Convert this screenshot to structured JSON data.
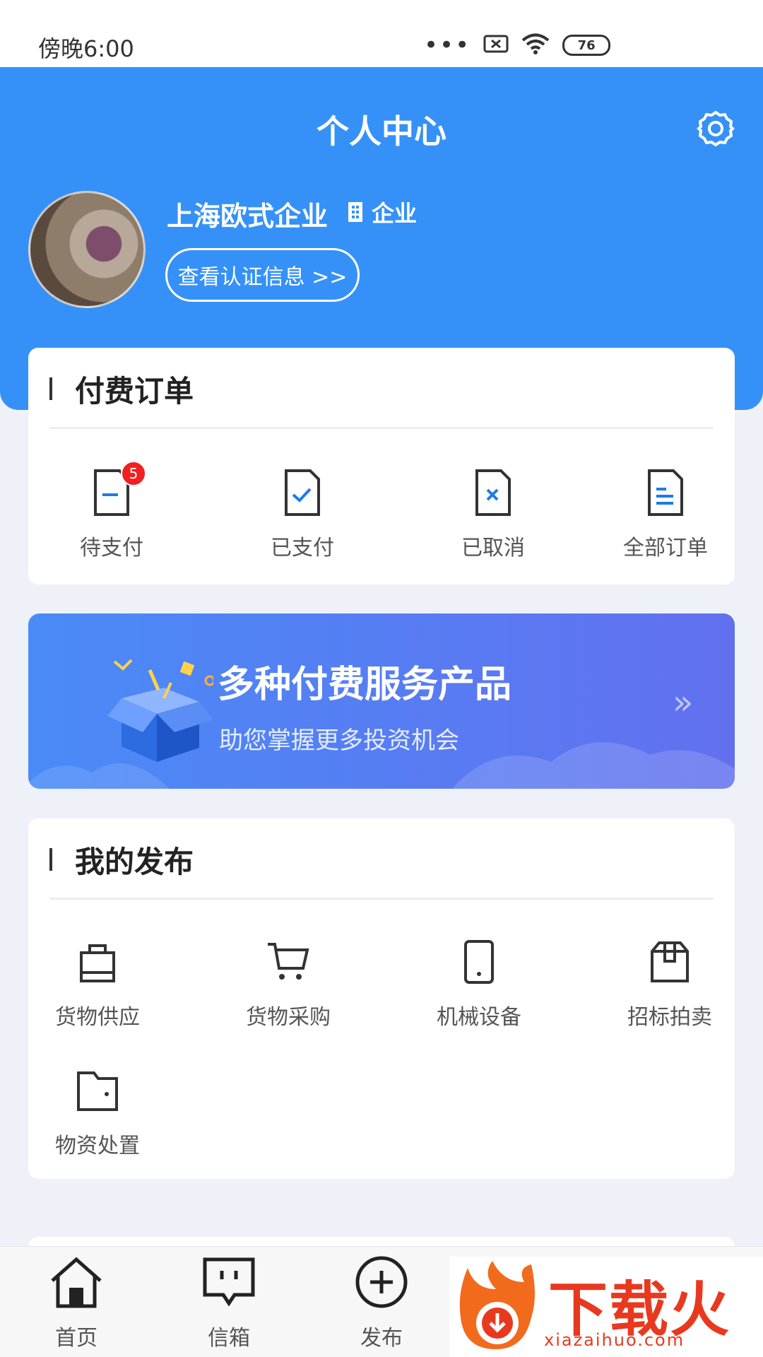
{
  "status_bar": {
    "time": "傍晚6:00",
    "dots": "•••",
    "battery": "76"
  },
  "header": {
    "title": "个人中心",
    "company_name": "上海欧式企业",
    "company_type": "企业",
    "cert_button": "查看认证信息 >>"
  },
  "paid_orders": {
    "title": "付费订单",
    "items": [
      {
        "label": "待支付",
        "badge": "5",
        "icon": "doc-minus-icon"
      },
      {
        "label": "已支付",
        "icon": "doc-check-icon"
      },
      {
        "label": "已取消",
        "icon": "doc-x-icon"
      },
      {
        "label": "全部订单",
        "icon": "doc-list-icon"
      }
    ]
  },
  "banner": {
    "title": "多种付费服务产品",
    "subtitle": "助您掌握更多投资机会",
    "arrow": "»"
  },
  "my_posts": {
    "title": "我的发布",
    "items": [
      {
        "label": "货物供应",
        "icon": "bag-icon"
      },
      {
        "label": "货物采购",
        "icon": "cart-icon"
      },
      {
        "label": "机械设备",
        "icon": "tablet-icon"
      },
      {
        "label": "招标拍卖",
        "icon": "box-icon"
      },
      {
        "label": "物资处置",
        "icon": "folder-icon"
      }
    ]
  },
  "bottom_nav": {
    "items": [
      {
        "label": "首页",
        "icon": "home-icon"
      },
      {
        "label": "信箱",
        "icon": "message-icon"
      },
      {
        "label": "发布",
        "icon": "plus-circle-icon"
      }
    ]
  },
  "watermark": {
    "text": "下载火",
    "domain": "xiazaihuo.com"
  },
  "colors": {
    "primary": "#3591F7",
    "badge": "#F02020",
    "background": "#EEF1F8"
  }
}
